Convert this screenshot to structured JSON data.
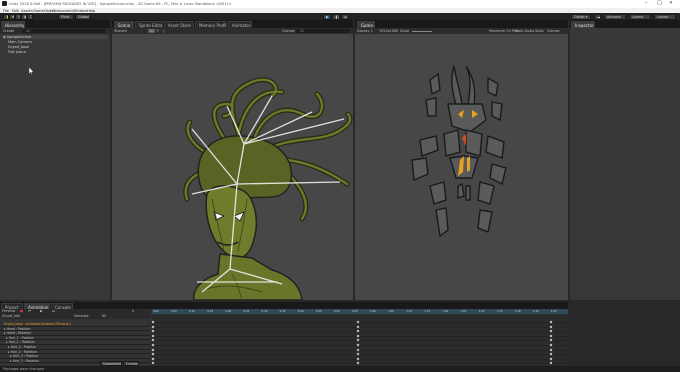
{
  "title_bar": {
    "text": "Unity 2018.3.0b6 - [PREVIEW PACKAGES IN USE] - SampleScene.unity - 2D Game Kit - PC, Mac & Linux Standalone <DX11>",
    "minimize": "–",
    "maximize": "□",
    "close": "✕"
  },
  "menu": [
    "File",
    "Edit",
    "Assets",
    "GameObject",
    "Component",
    "Window",
    "Help"
  ],
  "toolbar": {
    "pivot": "Pivot",
    "global": "Global",
    "collab": "Collab ▾",
    "account": "Account",
    "layers": "Layers",
    "layout": "Layout"
  },
  "hierarchy": {
    "tab": "Hierarchy",
    "create": "Create",
    "search_placeholder": "All",
    "items": [
      "SampleScene",
      "Main Camera",
      "Dryad_base",
      "Flat plane"
    ]
  },
  "scene_tabs": [
    "Scene",
    "Sprite Editor",
    "Asset Store",
    "Memory Profiler",
    "Animator"
  ],
  "scene_toolbar": {
    "mode": "Shaded",
    "mode2d": "2D",
    "gizmos": "Gizmos",
    "search": "All"
  },
  "game": {
    "tab": "Game",
    "display": "Display 1",
    "resolution": "1920x1080",
    "scale_label": "Scale",
    "maximize": "Maximize On Play",
    "mute": "Mute Audio",
    "stats": "Stats",
    "gizmos": "Gizmos"
  },
  "inspector": {
    "tab": "Inspector"
  },
  "bottom_tabs": [
    "Project",
    "Animation",
    "Console"
  ],
  "animation": {
    "preview": "Preview",
    "frame": "0",
    "clip": "Dryad_Idle",
    "samples_label": "Samples",
    "samples": "60",
    "properties": [
      "Dryad_base : Animator.Enabled (Missing!)",
      "▸ Head : Position",
      "▸ Head : Rotation",
      "▸ Hair_1 : Position",
      "▸ Hair_1 : Rotation",
      "▸ Hair_2 : Position",
      "▸ Hair_2 : Rotation",
      "▸ Hair_3 : Position",
      "▸ Hair_3 : Rotation",
      "▸ Hair_4 : Position",
      "▸ Hair_4 : Rotation"
    ],
    "dopesheet": "Dopesheet",
    "curves": "Curves",
    "ruler": [
      "0:00",
      "0:05",
      "0:10",
      "0:15",
      "0:20",
      "0:25",
      "0:30",
      "0:35",
      "0:40",
      "0:45",
      "0:50",
      "0:55",
      "1:00",
      "1:05",
      "1:10",
      "1:15",
      "1:20",
      "1:25",
      "1:30",
      "1:35",
      "1:40",
      "1:45",
      "1:50"
    ]
  },
  "status_bar": {
    "text": "Packages were changed"
  },
  "colors": {
    "editor_bg": "#282828",
    "scene_bg": "#474747",
    "timeline_ruler": "#2e4a55",
    "highlight_orange": "#e8a020"
  }
}
